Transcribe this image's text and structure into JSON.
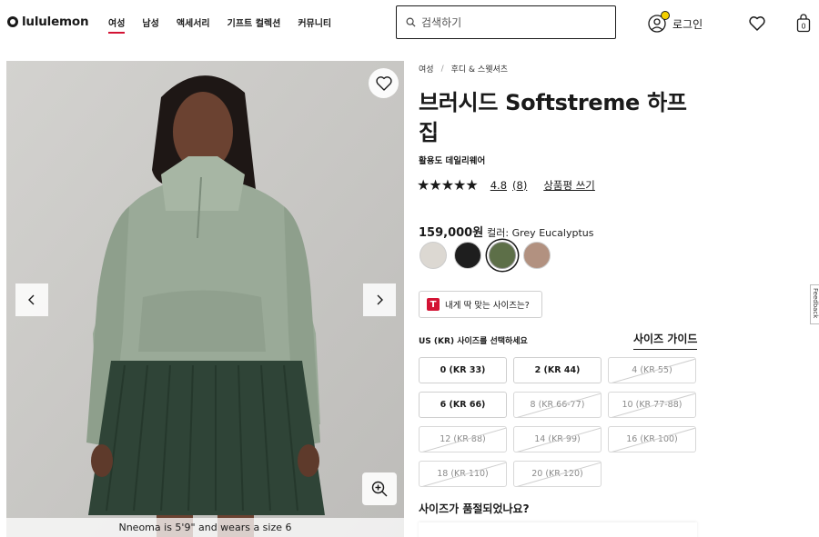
{
  "header": {
    "logo_text": "lululemon",
    "nav": [
      "여성",
      "남성",
      "액세서리",
      "기프트 컬렉션",
      "커뮤니티"
    ],
    "search_placeholder": "검색하기",
    "login_label": "로그인",
    "bag_count": "0"
  },
  "gallery": {
    "caption": "Nneoma is 5'9\" and wears a size 6"
  },
  "product": {
    "breadcrumb": [
      "여성",
      "후디 & 스웻셔츠"
    ],
    "title": "브러시드 Softstreme 하프 집",
    "subtitle": "활용도 데일리웨어",
    "stars": "★★★★★",
    "rating": "4.8",
    "review_count": "(8)",
    "write_review": "상품평 쓰기",
    "price": "159,000원",
    "color_label": "컬러: Grey Eucalyptus",
    "swatches": [
      {
        "color": "#dcd8d2",
        "selected": false
      },
      {
        "color": "#1e1e1e",
        "selected": false
      },
      {
        "color": "#5d6f48",
        "selected": true
      },
      {
        "color": "#b29180",
        "selected": false
      }
    ],
    "fit_logo": "T",
    "fit_label": "내게 딱 맞는 사이즈는?",
    "size_select_label": "US (KR) 사이즈를 선택하세요",
    "size_guide": "사이즈 가이드",
    "sizes": [
      {
        "label": "0 (KR 33)",
        "available": true
      },
      {
        "label": "2 (KR 44)",
        "available": true
      },
      {
        "label": "4 (KR 55)",
        "available": false
      },
      {
        "label": "6 (KR 66)",
        "available": true
      },
      {
        "label": "8 (KR 66-77)",
        "available": false
      },
      {
        "label": "10 (KR 77-88)",
        "available": false
      },
      {
        "label": "12 (KR 88)",
        "available": false
      },
      {
        "label": "14 (KR 99)",
        "available": false
      },
      {
        "label": "16 (KR 100)",
        "available": false
      },
      {
        "label": "18 (KR 110)",
        "available": false
      },
      {
        "label": "20 (KR 120)",
        "available": false
      }
    ],
    "sold_out_question": "사이즈가 품절되었나요?"
  },
  "feedback_label": "Feedback"
}
